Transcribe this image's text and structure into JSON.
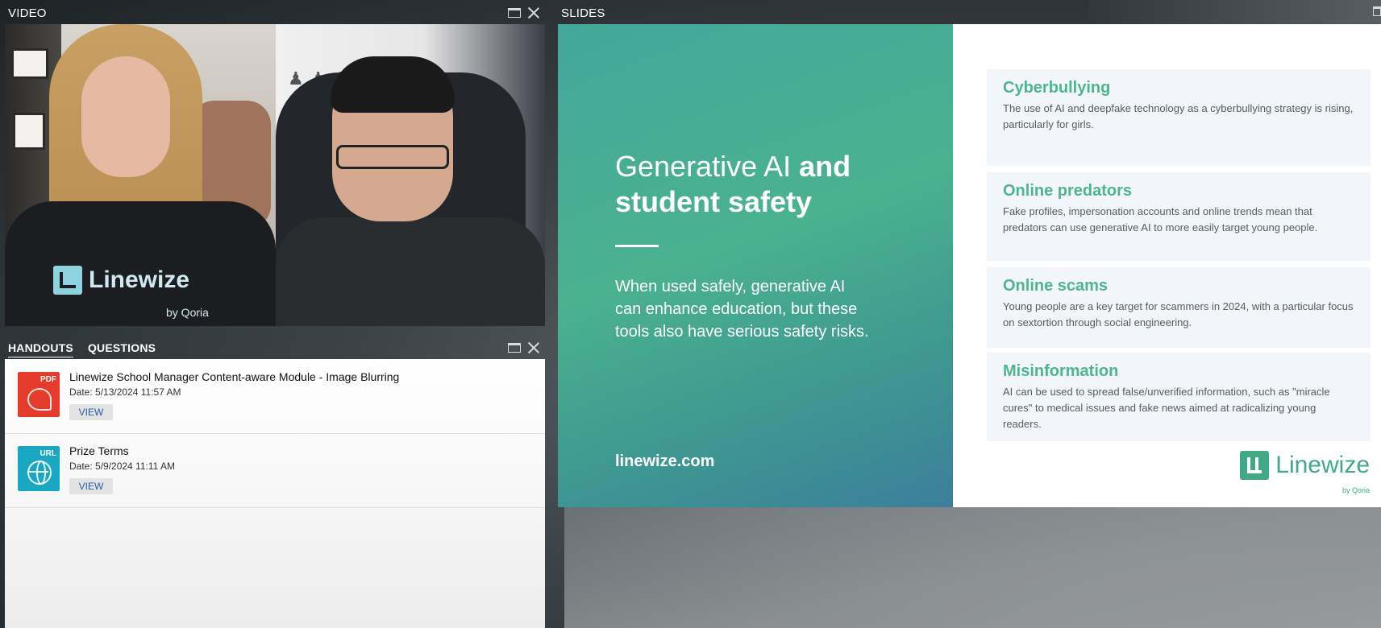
{
  "video_panel": {
    "title": "VIDEO"
  },
  "video_feeds": {
    "host_shirt_logo": "Linewize",
    "host_shirt_sub": "by Qoria"
  },
  "handouts_panel": {
    "tabs": [
      {
        "label": "HANDOUTS",
        "active": true
      },
      {
        "label": "QUESTIONS",
        "active": false
      }
    ],
    "items": [
      {
        "type": "PDF",
        "icon": "pdf-icon",
        "title": "Linewize School Manager Content-aware Module - Image Blurring",
        "date": "Date: 5/13/2024 11:57 AM",
        "action": "VIEW"
      },
      {
        "type": "URL",
        "icon": "globe-icon",
        "title": "Prize Terms",
        "date": "Date: 5/9/2024 11:11 AM",
        "action": "VIEW"
      }
    ]
  },
  "slides_panel": {
    "title": "SLIDES"
  },
  "slide": {
    "heading_light": "Generative AI ",
    "heading_bold": "and student safety",
    "body": "When used safely, generative AI can enhance education, but these tools also have serious safety risks.",
    "url": "linewize.com",
    "risks": [
      {
        "title": "Cyberbullying",
        "desc": "The use of AI and deepfake technology as a cyberbullying strategy is rising, particularly for girls."
      },
      {
        "title": "Online predators",
        "desc": "Fake profiles, impersonation accounts and online trends mean that predators can use generative AI to more easily target young people."
      },
      {
        "title": "Online scams",
        "desc": "Young people are a key target for scammers in 2024, with a particular focus on sextortion through social engineering."
      },
      {
        "title": "Misinformation",
        "desc": "AI can be used to spread false/unverified information, such as \"miracle cures\" to medical issues and fake news aimed at radicalizing young readers."
      }
    ],
    "brand": "Linewize",
    "brand_sub": "by Qoria"
  },
  "colors": {
    "slide_accent": "#4db58f",
    "pdf_icon": "#e43b2c",
    "url_icon": "#1aa7c2",
    "view_link": "#1e5ea8"
  }
}
